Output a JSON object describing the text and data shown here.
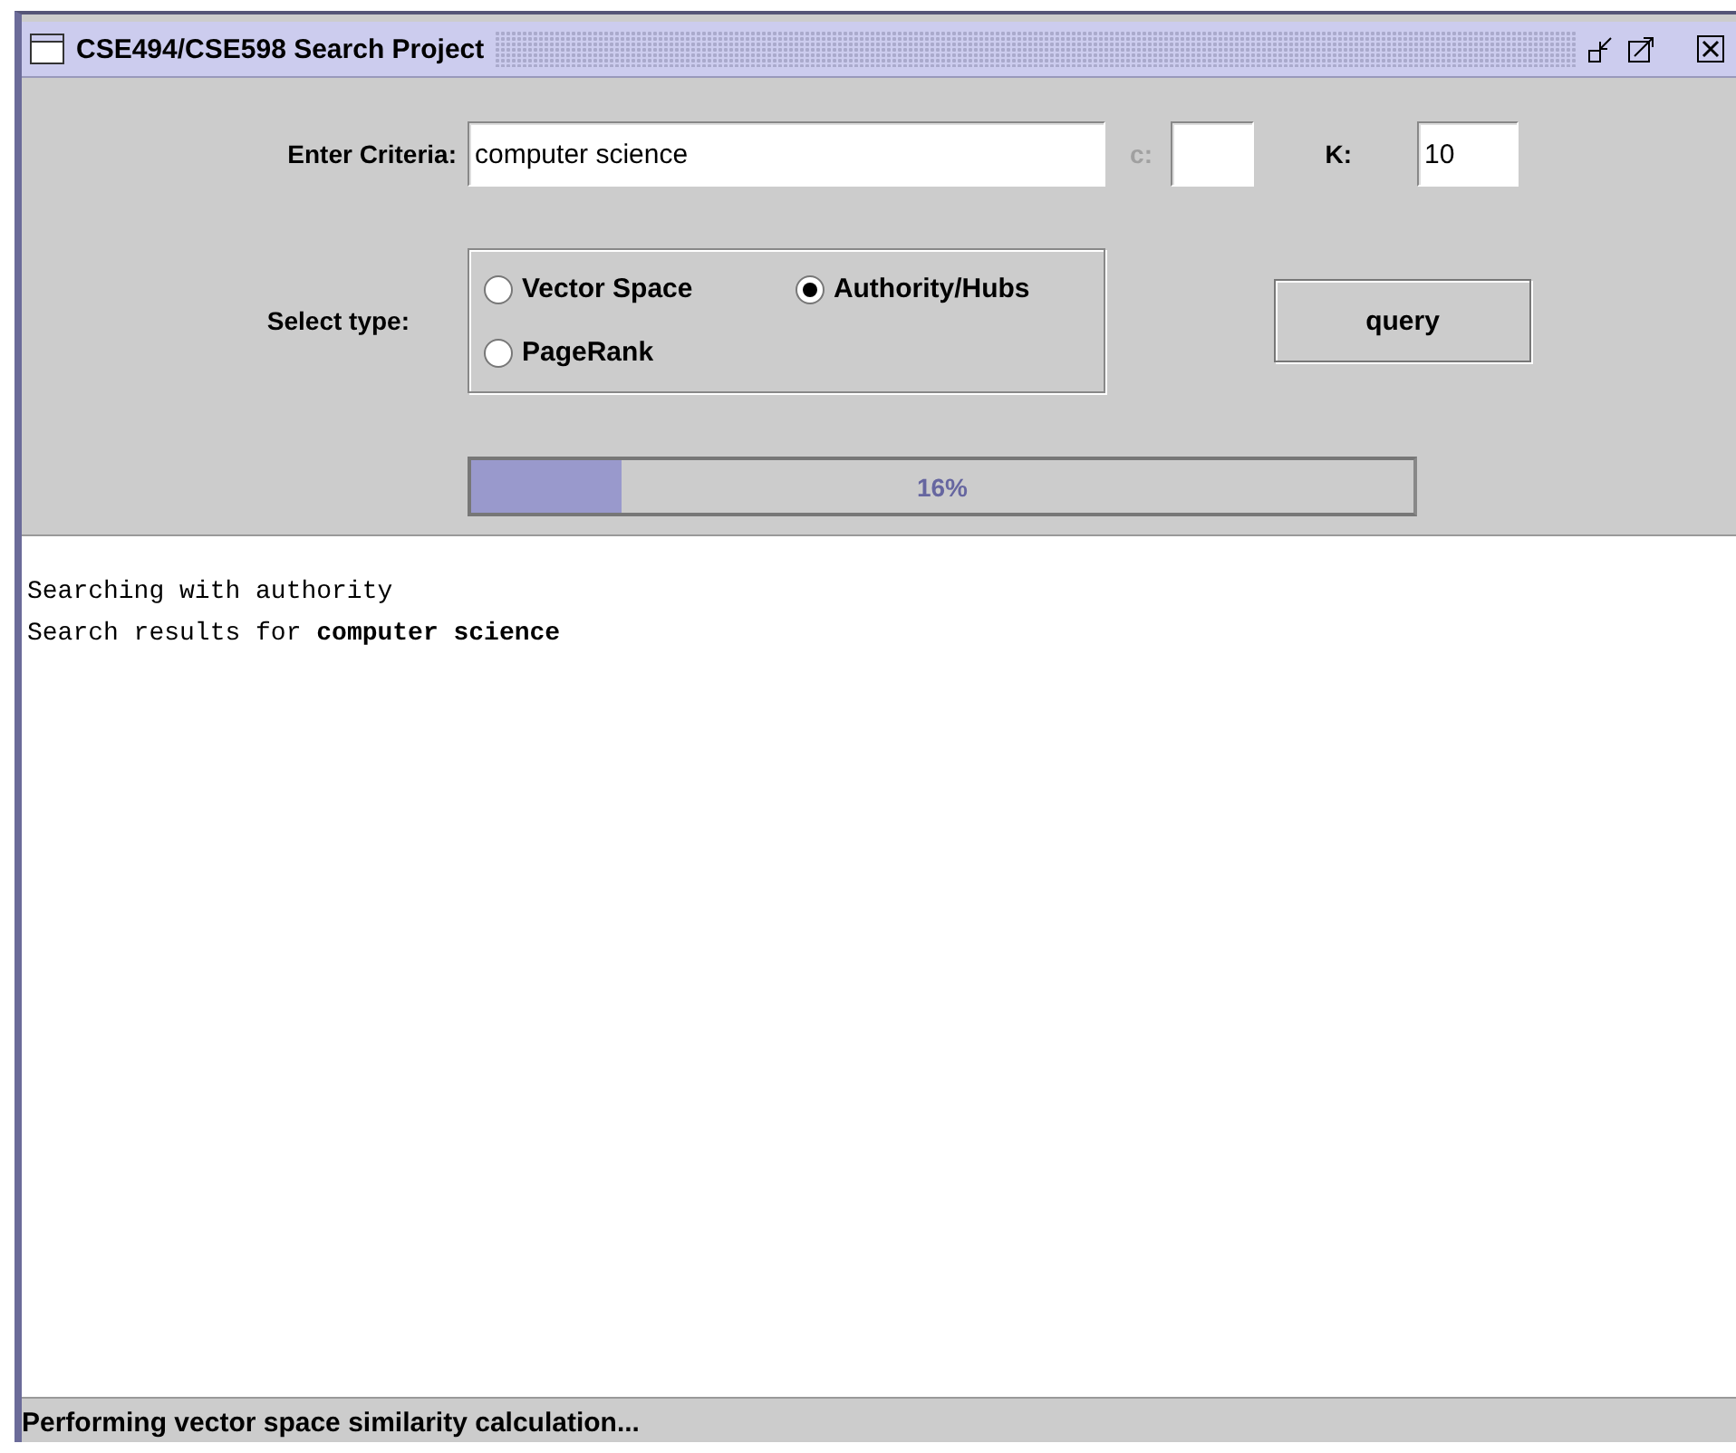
{
  "window": {
    "title": "CSE494/CSE598 Search Project"
  },
  "criteria": {
    "label": "Enter Criteria:",
    "value": "computer science"
  },
  "c_field": {
    "label": "c:",
    "disabled": true
  },
  "k_field": {
    "label": "K:",
    "value": "10"
  },
  "select_type": {
    "label": "Select type:",
    "options": [
      {
        "label": "Vector Space",
        "selected": false
      },
      {
        "label": "Authority/Hubs",
        "selected": true
      },
      {
        "label": "PageRank",
        "selected": false
      }
    ]
  },
  "query_button": {
    "label": "query"
  },
  "progress": {
    "level": 0.16,
    "reading": "16%"
  },
  "output": {
    "lines": [
      "Searching with authority",
      "Search results for **computer science**"
    ]
  },
  "status_bar": "Performing vector space similarity calculation..."
}
